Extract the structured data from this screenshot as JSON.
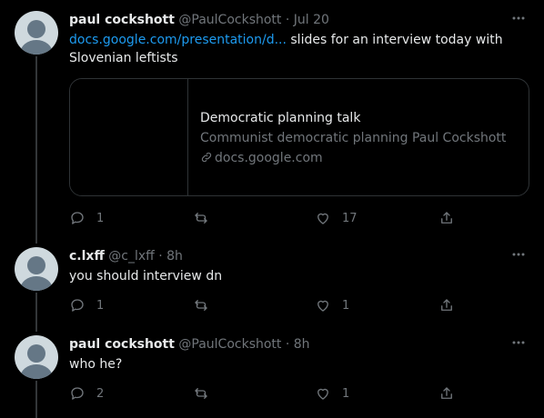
{
  "tweets": [
    {
      "name": "paul cockshott",
      "handle": "@PaulCockshott",
      "separator": "·",
      "time": "Jul 20",
      "link_text": "docs.google.com/presentation/d...",
      "text": " slides for an interview today with Slovenian leftists",
      "card": {
        "title": "Democratic planning talk",
        "description": "Communist democratic planning Paul Cockshott",
        "domain": "docs.google.com"
      },
      "replies": "1",
      "retweets": "",
      "likes": "17"
    },
    {
      "name": "c.lxff",
      "handle": "@c_lxff",
      "separator": "·",
      "time": "8h",
      "text": "you should interview dn",
      "replies": "1",
      "retweets": "",
      "likes": "1"
    },
    {
      "name": "paul cockshott",
      "handle": "@PaulCockshott",
      "separator": "·",
      "time": "8h",
      "text": "who he?",
      "replies": "2",
      "retweets": "",
      "likes": "1"
    }
  ],
  "icons": {
    "more": "more-icon",
    "reply": "reply-icon",
    "retweet": "retweet-icon",
    "like": "heart-icon",
    "share": "share-icon",
    "link": "link-icon"
  },
  "colors": {
    "background": "#000000",
    "text": "#e7e9ea",
    "muted": "#71767b",
    "link": "#1d9bf0",
    "border": "#2f3336"
  }
}
